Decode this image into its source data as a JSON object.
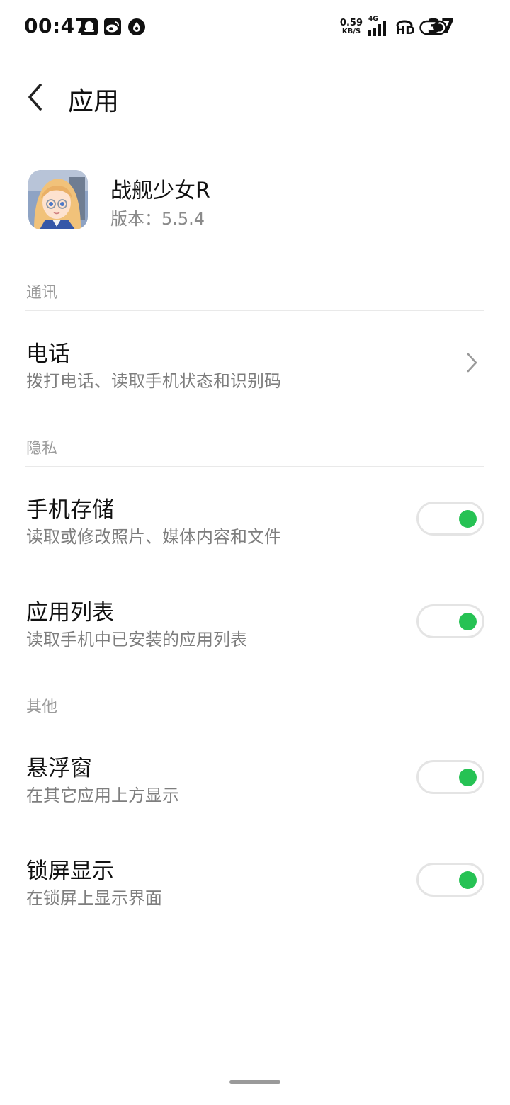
{
  "status_bar": {
    "time": "00:47",
    "notification_icons": [
      "qq-icon",
      "weibo-icon",
      "app-notification-icon"
    ],
    "net_speed_value": "0.59",
    "net_speed_unit": "KB/S",
    "network_type": "4G",
    "hd_label": "HD",
    "battery_level": "37"
  },
  "header": {
    "title": "应用",
    "back_icon": "chevron-left-icon"
  },
  "app_info": {
    "name": "战舰少女R",
    "version": "版本：5.5.4"
  },
  "sections": [
    {
      "header": "通讯",
      "items": [
        {
          "title": "电话",
          "description": "拨打电话、读取手机状态和识别码",
          "control": "chevron"
        }
      ]
    },
    {
      "header": "隐私",
      "items": [
        {
          "title": "手机存储",
          "description": "读取或修改照片、媒体内容和文件",
          "control": "toggle",
          "enabled": true
        },
        {
          "title": "应用列表",
          "description": "读取手机中已安装的应用列表",
          "control": "toggle",
          "enabled": true
        }
      ]
    },
    {
      "header": "其他",
      "items": [
        {
          "title": "悬浮窗",
          "description": "在其它应用上方显示",
          "control": "toggle",
          "enabled": true
        },
        {
          "title": "锁屏显示",
          "description": "在锁屏上显示界面",
          "control": "toggle",
          "enabled": true
        }
      ]
    }
  ],
  "colors": {
    "toggle_on": "#26c254",
    "section_header": "#9b9b9b",
    "description": "#7e7e7e"
  }
}
